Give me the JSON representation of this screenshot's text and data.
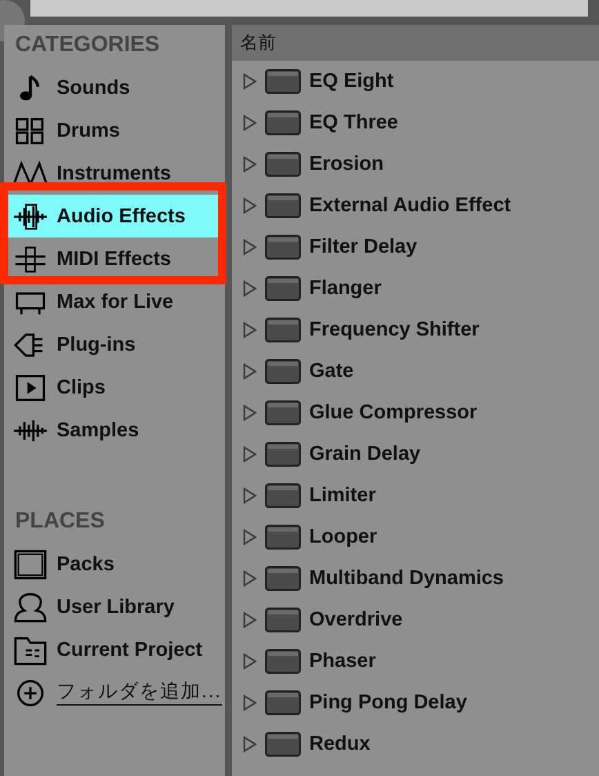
{
  "search": {
    "kind": "field"
  },
  "categories": {
    "title": "CATEGORIES",
    "items": [
      {
        "label": "Sounds",
        "selected": false
      },
      {
        "label": "Drums",
        "selected": false
      },
      {
        "label": "Instruments",
        "selected": false
      },
      {
        "label": "Audio Effects",
        "selected": true
      },
      {
        "label": "MIDI Effects",
        "selected": false
      },
      {
        "label": "Max for Live",
        "selected": false
      },
      {
        "label": "Plug-ins",
        "selected": false
      },
      {
        "label": "Clips",
        "selected": false
      },
      {
        "label": "Samples",
        "selected": false
      }
    ]
  },
  "places": {
    "title": "PLACES",
    "items": [
      {
        "label": "Packs",
        "kind": "item"
      },
      {
        "label": "User Library",
        "kind": "item"
      },
      {
        "label": "Current Project",
        "kind": "item"
      },
      {
        "label": "フォルダを追加...",
        "kind": "link"
      }
    ]
  },
  "annotation": {
    "color": "#ff2a00"
  },
  "list": {
    "column": "名前",
    "rows": [
      "EQ Eight",
      "EQ Three",
      "Erosion",
      "External Audio Effect",
      "Filter Delay",
      "Flanger",
      "Frequency Shifter",
      "Gate",
      "Glue Compressor",
      "Grain Delay",
      "Limiter",
      "Looper",
      "Multiband Dynamics",
      "Overdrive",
      "Phaser",
      "Ping Pong Delay",
      "Redux"
    ]
  }
}
